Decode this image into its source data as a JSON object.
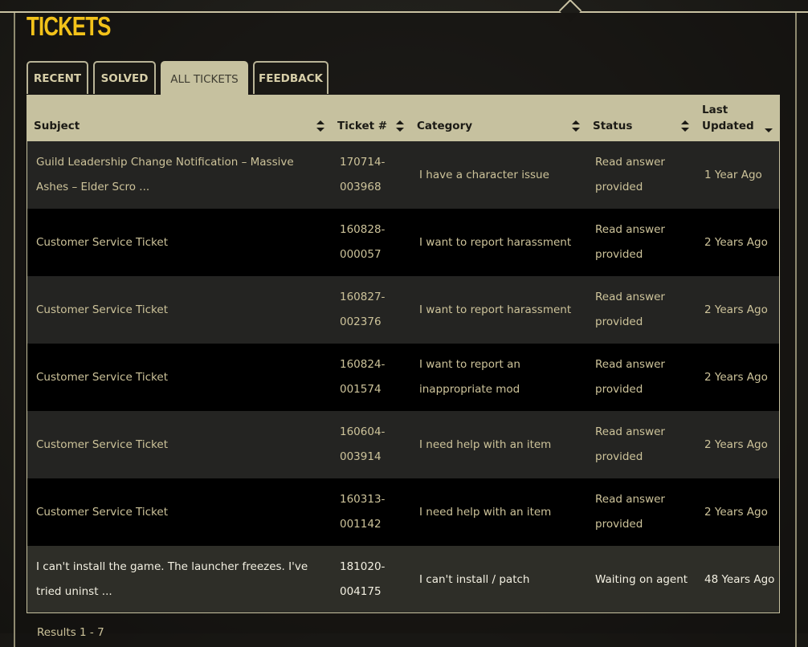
{
  "page": {
    "title": "TICKETS"
  },
  "tabs": [
    {
      "label": "RECENT"
    },
    {
      "label": "SOLVED"
    },
    {
      "label": "ALL TICKETS",
      "active": true
    },
    {
      "label": "FEEDBACK"
    }
  ],
  "table": {
    "headers": {
      "subject": "Subject",
      "ticket": "Ticket #",
      "category": "Category",
      "status": "Status",
      "updated_line1": "Last",
      "updated_line2": "Updated"
    },
    "rows": [
      {
        "subject": "Guild Leadership Change Notification – Massive Ashes – Elder Scro ...",
        "ticket_a": "170714-",
        "ticket_b": "003968",
        "category": "I have a character issue",
        "status": "Read answer provided",
        "updated": "1 Year Ago"
      },
      {
        "subject": "Customer Service Ticket",
        "ticket_a": "160828-",
        "ticket_b": "000057",
        "category": "I want to report harassment",
        "status": "Read answer provided",
        "updated": "2 Years Ago"
      },
      {
        "subject": "Customer Service Ticket",
        "ticket_a": "160827-",
        "ticket_b": "002376",
        "category": "I want to report harassment",
        "status": "Read answer provided",
        "updated": "2 Years Ago"
      },
      {
        "subject": "Customer Service Ticket",
        "ticket_a": "160824-",
        "ticket_b": "001574",
        "category": "I want to report an inappropriate mod",
        "status": "Read answer provided",
        "updated": "2 Years Ago"
      },
      {
        "subject": "Customer Service Ticket",
        "ticket_a": "160604-",
        "ticket_b": "003914",
        "category": "I need help with an item",
        "status": "Read answer provided",
        "updated": "2 Years Ago"
      },
      {
        "subject": "Customer Service Ticket",
        "ticket_a": "160313-",
        "ticket_b": "001142",
        "category": "I need help with an item",
        "status": "Read answer provided",
        "updated": "2 Years Ago"
      },
      {
        "subject": "I can't install the game. The launcher freezes. I've tried uninst ...",
        "ticket_a": "181020-",
        "ticket_b": "004175",
        "category": "I can't install / patch",
        "status": "Waiting on agent",
        "updated": "48 Years Ago"
      }
    ]
  },
  "footer": {
    "results": "Results 1 - 7"
  },
  "colors": {
    "accent_title": "#f2c21a",
    "header_bg": "#c6c19f",
    "link_text": "#cdc39a"
  }
}
